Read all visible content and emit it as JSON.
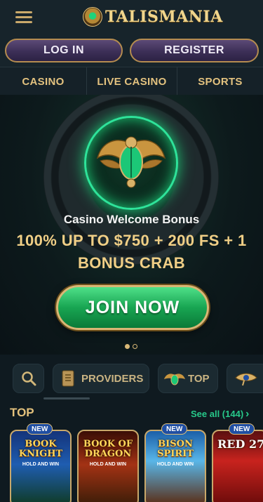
{
  "header": {
    "logo_text": "TALISMANIA"
  },
  "auth": {
    "login_label": "LOG IN",
    "register_label": "REGISTER"
  },
  "nav": {
    "items": [
      "CASINO",
      "LIVE CASINO",
      "SPORTS"
    ]
  },
  "hero": {
    "subtitle": "Casino Welcome Bonus",
    "title": "100% UP TO $750 + 200 FS + 1 BONUS CRAB",
    "cta_label": "JOIN NOW",
    "slides_total": 2,
    "active_slide": 1
  },
  "filters": {
    "providers_label": "PROVIDERS",
    "top_label": "TOP"
  },
  "section": {
    "title": "TOP",
    "see_all_label": "See all (144)"
  },
  "games": [
    {
      "title": "BOOK KNIGHT",
      "sub": "HOLD AND WIN",
      "badge": "NEW"
    },
    {
      "title": "BOOK OF DRAGON",
      "sub": "HOLD AND WIN",
      "badge": ""
    },
    {
      "title": "BISON SPIRIT",
      "sub": "HOLD AND WIN",
      "badge": "NEW"
    },
    {
      "title": "RED 27",
      "sub": "",
      "badge": "NEW"
    }
  ],
  "colors": {
    "accent_gold": "#e4c27d",
    "link_green": "#27c98a",
    "cta_green": "#18a552"
  }
}
